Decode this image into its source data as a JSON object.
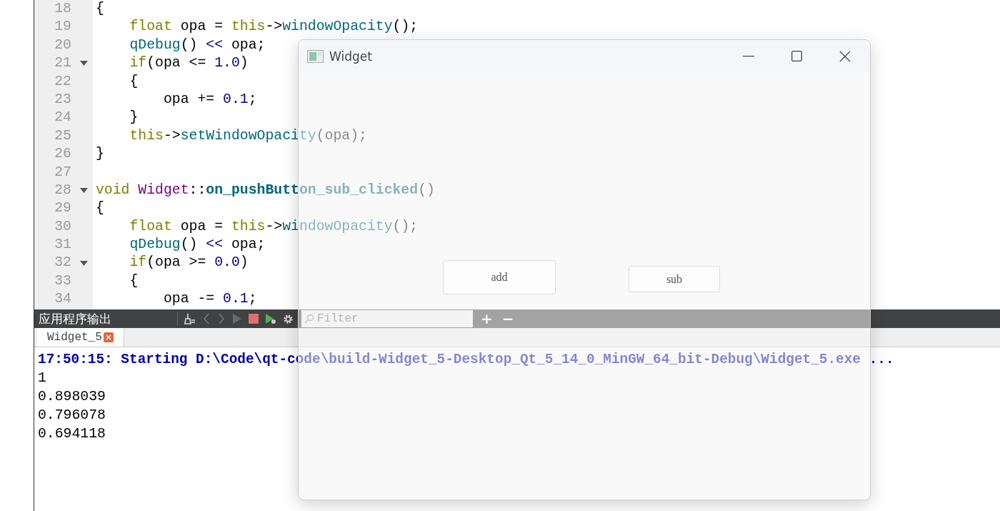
{
  "code_editor": {
    "lines": [
      {
        "number": "18",
        "foldable": false,
        "tokens": [
          {
            "text": "{",
            "kind": "plain"
          }
        ]
      },
      {
        "number": "19",
        "foldable": false,
        "tokens": [
          {
            "text": "    float",
            "kind": "keyword"
          },
          {
            "text": " opa = ",
            "kind": "plain"
          },
          {
            "text": "this",
            "kind": "keyword"
          },
          {
            "text": "->",
            "kind": "plain"
          },
          {
            "text": "windowOpacity",
            "kind": "function"
          },
          {
            "text": "();",
            "kind": "plain"
          }
        ]
      },
      {
        "number": "20",
        "foldable": false,
        "tokens": [
          {
            "text": "    qDebug",
            "kind": "function"
          },
          {
            "text": "() ",
            "kind": "plain"
          },
          {
            "text": "<<",
            "kind": "operator"
          },
          {
            "text": " opa;",
            "kind": "plain"
          }
        ]
      },
      {
        "number": "21",
        "foldable": true,
        "tokens": [
          {
            "text": "    if",
            "kind": "keyword"
          },
          {
            "text": "(opa <= ",
            "kind": "plain"
          },
          {
            "text": "1.0",
            "kind": "number"
          },
          {
            "text": ")",
            "kind": "plain"
          }
        ]
      },
      {
        "number": "22",
        "foldable": false,
        "tokens": [
          {
            "text": "    {",
            "kind": "plain"
          }
        ]
      },
      {
        "number": "23",
        "foldable": false,
        "tokens": [
          {
            "text": "        opa += ",
            "kind": "plain"
          },
          {
            "text": "0.1",
            "kind": "number"
          },
          {
            "text": ";",
            "kind": "plain"
          }
        ]
      },
      {
        "number": "24",
        "foldable": false,
        "tokens": [
          {
            "text": "    }",
            "kind": "plain"
          }
        ]
      },
      {
        "number": "25",
        "foldable": false,
        "tokens": [
          {
            "text": "    this",
            "kind": "keyword"
          },
          {
            "text": "->",
            "kind": "plain"
          },
          {
            "text": "setWindowOpacity",
            "kind": "function"
          },
          {
            "text": "(opa);",
            "kind": "plain"
          }
        ]
      },
      {
        "number": "26",
        "foldable": false,
        "tokens": [
          {
            "text": "}",
            "kind": "plain"
          }
        ]
      },
      {
        "number": "27",
        "foldable": false
      },
      {
        "number": "28",
        "foldable": true,
        "tokens": [
          {
            "text": "void",
            "kind": "keyword"
          },
          {
            "text": " Widget",
            "kind": "type"
          },
          {
            "text": "::",
            "kind": "plain"
          },
          {
            "text": "on_pushButton_sub_clicked",
            "kind": "declaration"
          },
          {
            "text": "()",
            "kind": "plain"
          }
        ]
      },
      {
        "number": "29",
        "foldable": false,
        "tokens": [
          {
            "text": "{",
            "kind": "plain"
          }
        ]
      },
      {
        "number": "30",
        "foldable": false,
        "tokens": [
          {
            "text": "    float",
            "kind": "keyword"
          },
          {
            "text": " opa = ",
            "kind": "plain"
          },
          {
            "text": "this",
            "kind": "keyword"
          },
          {
            "text": "->",
            "kind": "plain"
          },
          {
            "text": "windowOpacity",
            "kind": "function"
          },
          {
            "text": "();",
            "kind": "plain"
          }
        ]
      },
      {
        "number": "31",
        "foldable": false,
        "tokens": [
          {
            "text": "    qDebug",
            "kind": "function"
          },
          {
            "text": "() ",
            "kind": "plain"
          },
          {
            "text": "<<",
            "kind": "operator"
          },
          {
            "text": " opa;",
            "kind": "plain"
          }
        ]
      },
      {
        "number": "32",
        "foldable": true,
        "tokens": [
          {
            "text": "    if",
            "kind": "keyword"
          },
          {
            "text": "(opa >= ",
            "kind": "plain"
          },
          {
            "text": "0.0",
            "kind": "number"
          },
          {
            "text": ")",
            "kind": "plain"
          }
        ]
      },
      {
        "number": "33",
        "foldable": false,
        "tokens": [
          {
            "text": "    {",
            "kind": "plain"
          }
        ]
      },
      {
        "number": "34",
        "foldable": false,
        "tokens": [
          {
            "text": "        opa -= ",
            "kind": "plain"
          },
          {
            "text": "0.1",
            "kind": "number"
          },
          {
            "text": ";",
            "kind": "plain"
          }
        ]
      }
    ]
  },
  "output_pane": {
    "title": "应用程序输出",
    "toolbar": [
      {
        "kind": "clear",
        "disabled": false
      },
      {
        "kind": "back",
        "disabled": true
      },
      {
        "kind": "forward",
        "disabled": true
      },
      {
        "kind": "run",
        "disabled": true
      },
      {
        "kind": "stop",
        "disabled": false
      },
      {
        "kind": "debug",
        "disabled": false
      },
      {
        "kind": "settings",
        "disabled": false
      }
    ],
    "filter": {
      "placeholder": "Filter"
    },
    "zoom_in": "+",
    "zoom_out": "−",
    "tabs": [
      {
        "label": "Widget_5",
        "selected": true,
        "closable": true
      }
    ],
    "lines": [
      {
        "text": "17:50:15: Starting D:\\Code\\qt-code\\build-Widget_5-Desktop_Qt_5_14_0_MinGW_64_bit-Debug\\Widget_5.exe ...",
        "kind": "status"
      },
      {
        "text": "1",
        "kind": "plain"
      },
      {
        "text": "0.898039",
        "kind": "plain"
      },
      {
        "text": "0.796078",
        "kind": "plain"
      },
      {
        "text": "0.694118",
        "kind": "plain"
      }
    ]
  },
  "widget_window": {
    "title": "Widget",
    "buttons": [
      {
        "label": "add"
      },
      {
        "label": "sub"
      }
    ]
  }
}
